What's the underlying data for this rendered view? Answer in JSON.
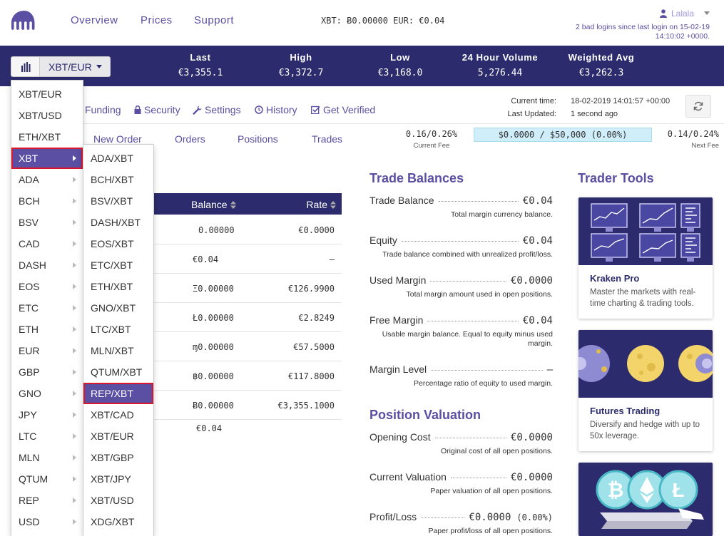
{
  "header": {
    "nav": [
      "Overview",
      "Prices",
      "Support"
    ],
    "balances": "XBT: Ƀ0.00000  EUR: €0.04",
    "username": "Lalala",
    "bad_logins": "2 bad logins since last login on 15-02-19 14:10:02 +0000."
  },
  "ticker": {
    "pair": "XBT/EUR",
    "columns": [
      {
        "label": "Last",
        "value": "€3,355.1"
      },
      {
        "label": "High",
        "value": "€3,372.7"
      },
      {
        "label": "Low",
        "value": "€3,168.0"
      },
      {
        "label": "24 Hour Volume",
        "value": "5,276.44"
      },
      {
        "label": "Weighted Avg",
        "value": "€3,262.3"
      }
    ]
  },
  "subnav": [
    "Funding",
    "Security",
    "Settings",
    "History",
    "Get Verified"
  ],
  "time": {
    "current_label": "Current time:",
    "current_value": "18-02-2019 14:01:57 +00:00",
    "updated_label": "Last Updated:",
    "updated_value": "1 second ago"
  },
  "tabs": [
    "New Order",
    "Orders",
    "Positions",
    "Trades"
  ],
  "fees": {
    "current": "0.16/0.26%",
    "current_label": "Current Fee",
    "progress": "$0.0000 / $50,000 (0.00%)",
    "next": "0.14/0.24%",
    "next_label": "Next Fee"
  },
  "balances_table": {
    "col_balance": "Balance",
    "col_rate": "Rate",
    "rows": [
      {
        "balance": "0.00000",
        "rate": "€0.0000"
      },
      {
        "balance": "€0.04",
        "rate": "—"
      },
      {
        "balance": "Ξ0.00000",
        "rate": "€126.9900"
      },
      {
        "balance": "Ł0.00000",
        "rate": "€2.8249"
      },
      {
        "balance": "ɱ0.00000",
        "rate": "€57.5000"
      },
      {
        "balance": "฿0.00000",
        "rate": "€117.8000"
      },
      {
        "balance": "Ƀ0.00000",
        "rate": "€3,355.1000"
      }
    ],
    "total": "€0.04"
  },
  "trade_balances": {
    "title": "Trade Balances",
    "items": [
      {
        "label": "Trade Balance",
        "value": "€0.04",
        "desc": "Total margin currency balance."
      },
      {
        "label": "Equity",
        "value": "€0.04",
        "desc": "Trade balance combined with unrealized profit/loss."
      },
      {
        "label": "Used Margin",
        "value": "€0.0000",
        "desc": "Total margin amount used in open positions."
      },
      {
        "label": "Free Margin",
        "value": "€0.04",
        "desc": "Usable margin balance. Equal to equity minus used margin."
      },
      {
        "label": "Margin Level",
        "value": "—",
        "desc": "Percentage ratio of equity to used margin."
      }
    ]
  },
  "position_valuation": {
    "title": "Position Valuation",
    "items": [
      {
        "label": "Opening Cost",
        "value": "€0.0000",
        "desc": "Original cost of all open positions."
      },
      {
        "label": "Current Valuation",
        "value": "€0.0000",
        "desc": "Paper valuation of all open positions."
      },
      {
        "label": "Profit/Loss",
        "value": "€0.0000",
        "extra": "(0.00%)",
        "desc": "Paper profit/loss of all open positions."
      }
    ]
  },
  "trader_tools": {
    "title": "Trader Tools",
    "cards": [
      {
        "title": "Kraken Pro",
        "desc": "Master the markets with real-time charting & trading tools."
      },
      {
        "title": "Futures Trading",
        "desc": "Diversify and hedge with up to 50x leverage."
      },
      {
        "title": "",
        "desc": ""
      }
    ]
  },
  "currency_menu": [
    "XBT/EUR",
    "XBT/USD",
    "ETH/XBT",
    "XBT",
    "ADA",
    "BCH",
    "BSV",
    "CAD",
    "DASH",
    "EOS",
    "ETC",
    "ETH",
    "EUR",
    "GBP",
    "GNO",
    "JPY",
    "LTC",
    "MLN",
    "QTUM",
    "REP",
    "USD"
  ],
  "xbt_submenu": [
    "ADA/XBT",
    "BCH/XBT",
    "BSV/XBT",
    "DASH/XBT",
    "EOS/XBT",
    "ETC/XBT",
    "ETH/XBT",
    "GNO/XBT",
    "LTC/XBT",
    "MLN/XBT",
    "QTUM/XBT",
    "REP/XBT",
    "XBT/CAD",
    "XBT/EUR",
    "XBT/GBP",
    "XBT/JPY",
    "XBT/USD",
    "XDG/XBT"
  ],
  "colors": {
    "brand": "#5a4fa3",
    "dark": "#2c2b6d",
    "highlight": "#d9182d"
  }
}
